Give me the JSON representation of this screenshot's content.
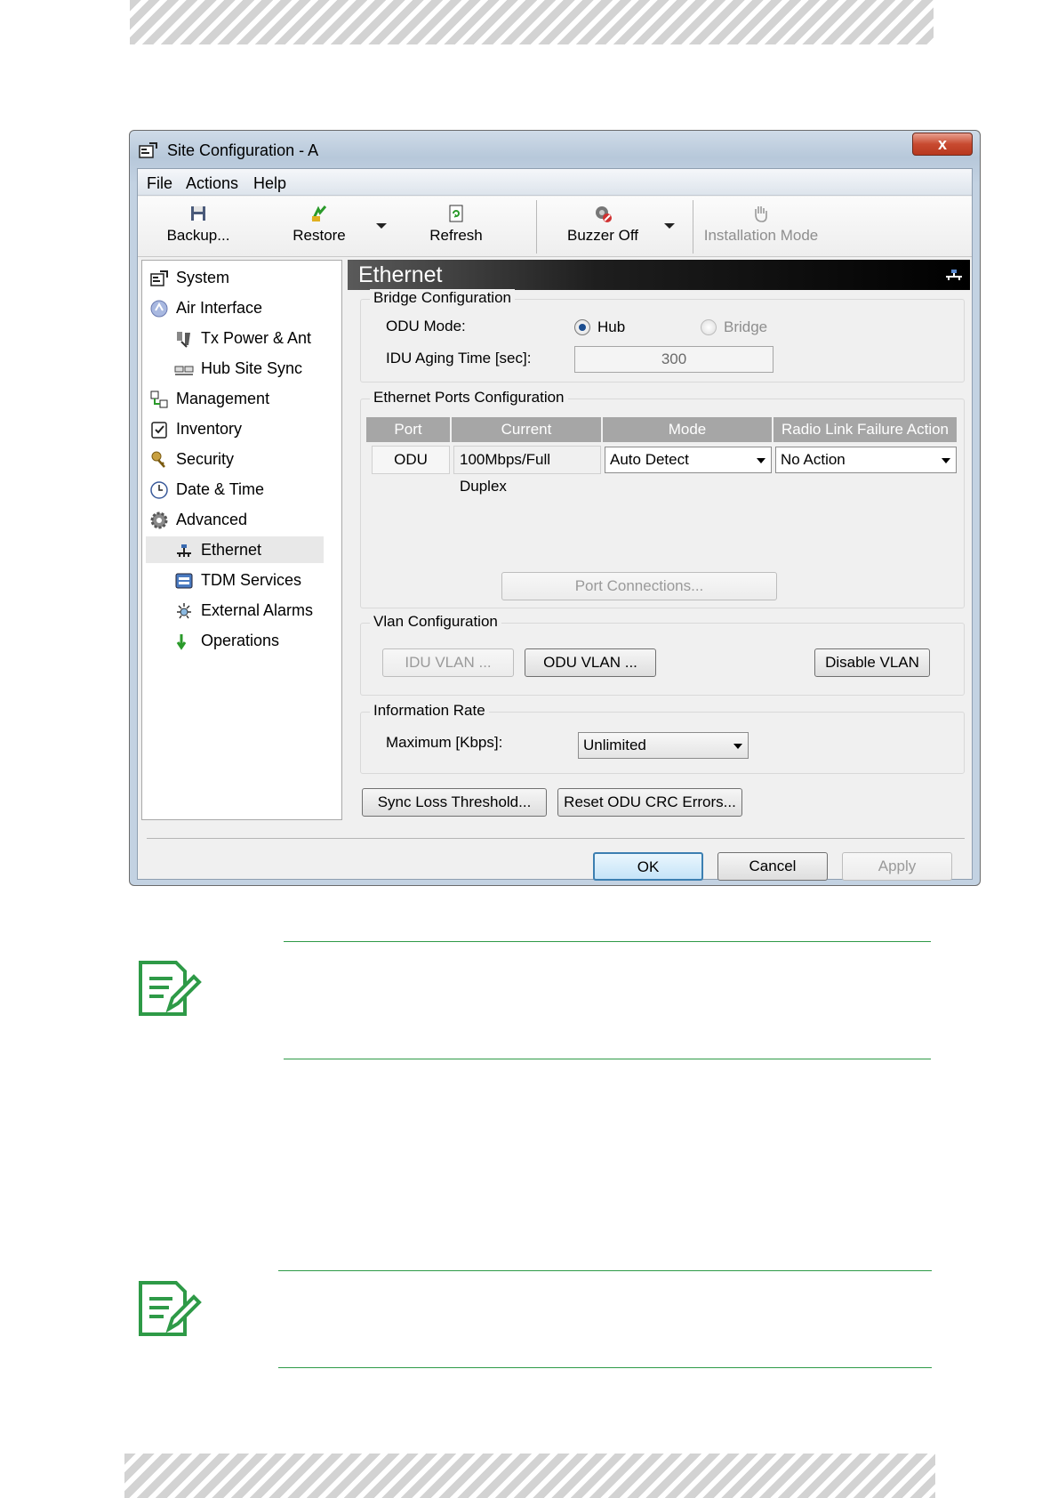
{
  "window": {
    "title": "Site Configuration - A",
    "close_label": "x"
  },
  "menu": [
    "File",
    "Actions",
    "Help"
  ],
  "toolbar": {
    "backup": "Backup...",
    "restore": "Restore",
    "refresh": "Refresh",
    "buzzer_off": "Buzzer Off",
    "installation_mode": "Installation Mode"
  },
  "tree": {
    "items": [
      {
        "label": "System",
        "icon": "system-icon"
      },
      {
        "label": "Air Interface",
        "icon": "air-interface-icon"
      },
      {
        "label": "Tx Power & Ant",
        "icon": "tx-power-icon"
      },
      {
        "label": "Hub Site Sync",
        "icon": "hub-sync-icon"
      },
      {
        "label": "Management",
        "icon": "management-icon"
      },
      {
        "label": "Inventory",
        "icon": "inventory-icon"
      },
      {
        "label": "Security",
        "icon": "security-icon"
      },
      {
        "label": "Date & Time",
        "icon": "clock-icon"
      },
      {
        "label": "Advanced",
        "icon": "gear-icon"
      },
      {
        "label": "Ethernet",
        "icon": "ethernet-icon",
        "selected": true
      },
      {
        "label": "TDM Services",
        "icon": "tdm-icon"
      },
      {
        "label": "External Alarms",
        "icon": "alarm-icon"
      },
      {
        "label": "Operations",
        "icon": "operations-icon"
      }
    ]
  },
  "panel": {
    "title": "Ethernet",
    "bridge": {
      "title": "Bridge Configuration",
      "odu_mode_label": "ODU Mode:",
      "hub_label": "Hub",
      "bridge_label": "Bridge",
      "aging_label": "IDU Aging Time [sec]:",
      "aging_value": "300"
    },
    "ports": {
      "title": "Ethernet Ports Configuration",
      "headers": [
        "Port",
        "Current",
        "Mode",
        "Radio Link Failure Action"
      ],
      "row": {
        "port": "ODU",
        "current": "100Mbps/Full Duplex",
        "mode": "Auto Detect",
        "action": "No Action"
      },
      "port_connections": "Port Connections..."
    },
    "vlan": {
      "title": "Vlan Configuration",
      "idu_vlan": "IDU VLAN ...",
      "odu_vlan": "ODU VLAN ...",
      "disable_vlan": "Disable VLAN"
    },
    "rate": {
      "title": "Information Rate",
      "max_label": "Maximum [Kbps]:",
      "max_value": "Unlimited"
    },
    "sync_loss": "Sync Loss Threshold...",
    "reset_crc": "Reset ODU CRC Errors..."
  },
  "footer": {
    "ok": "OK",
    "cancel": "Cancel",
    "apply": "Apply"
  },
  "colors": {
    "note_green": "#2e9a47",
    "header_black": "#000000"
  }
}
